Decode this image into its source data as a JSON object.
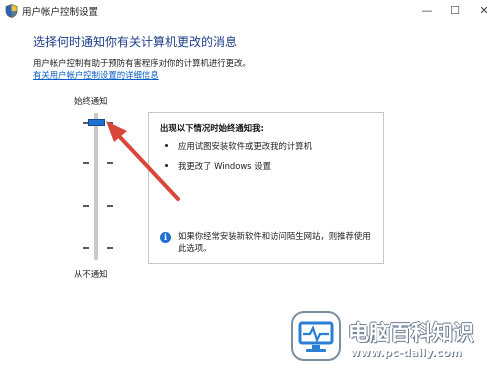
{
  "window": {
    "title": "用户帐户控制设置",
    "controls": {
      "minimize": "—",
      "maximize": "☐",
      "close": "✕"
    }
  },
  "main": {
    "heading": "选择何时通知你有关计算机更改的消息",
    "description": "用户帐户控制有助于预防有害程序对你的计算机进行更改。",
    "link": "有关用户帐户控制设置的详细信息"
  },
  "slider": {
    "top_label": "始终通知",
    "bottom_label": "从不通知",
    "current_level": 4,
    "level_count": 4
  },
  "panel": {
    "title": "出现以下情况时始终通知我:",
    "bullets": [
      "应用试图安装软件或更改我的计算机",
      "我更改了 Windows 设置"
    ],
    "recommendation": "如果你经常安装新软件和访问陌生网站，则推荐使用此选项。"
  },
  "watermark": {
    "site_name": "电脑百科知识",
    "url": "www.pc-daily.com"
  },
  "colors": {
    "heading": "#1e3f8a",
    "link": "#0a5ec7",
    "thumb": "#1f6fce",
    "arrow": "#d9463a",
    "watermark_text": "#ffffff"
  }
}
